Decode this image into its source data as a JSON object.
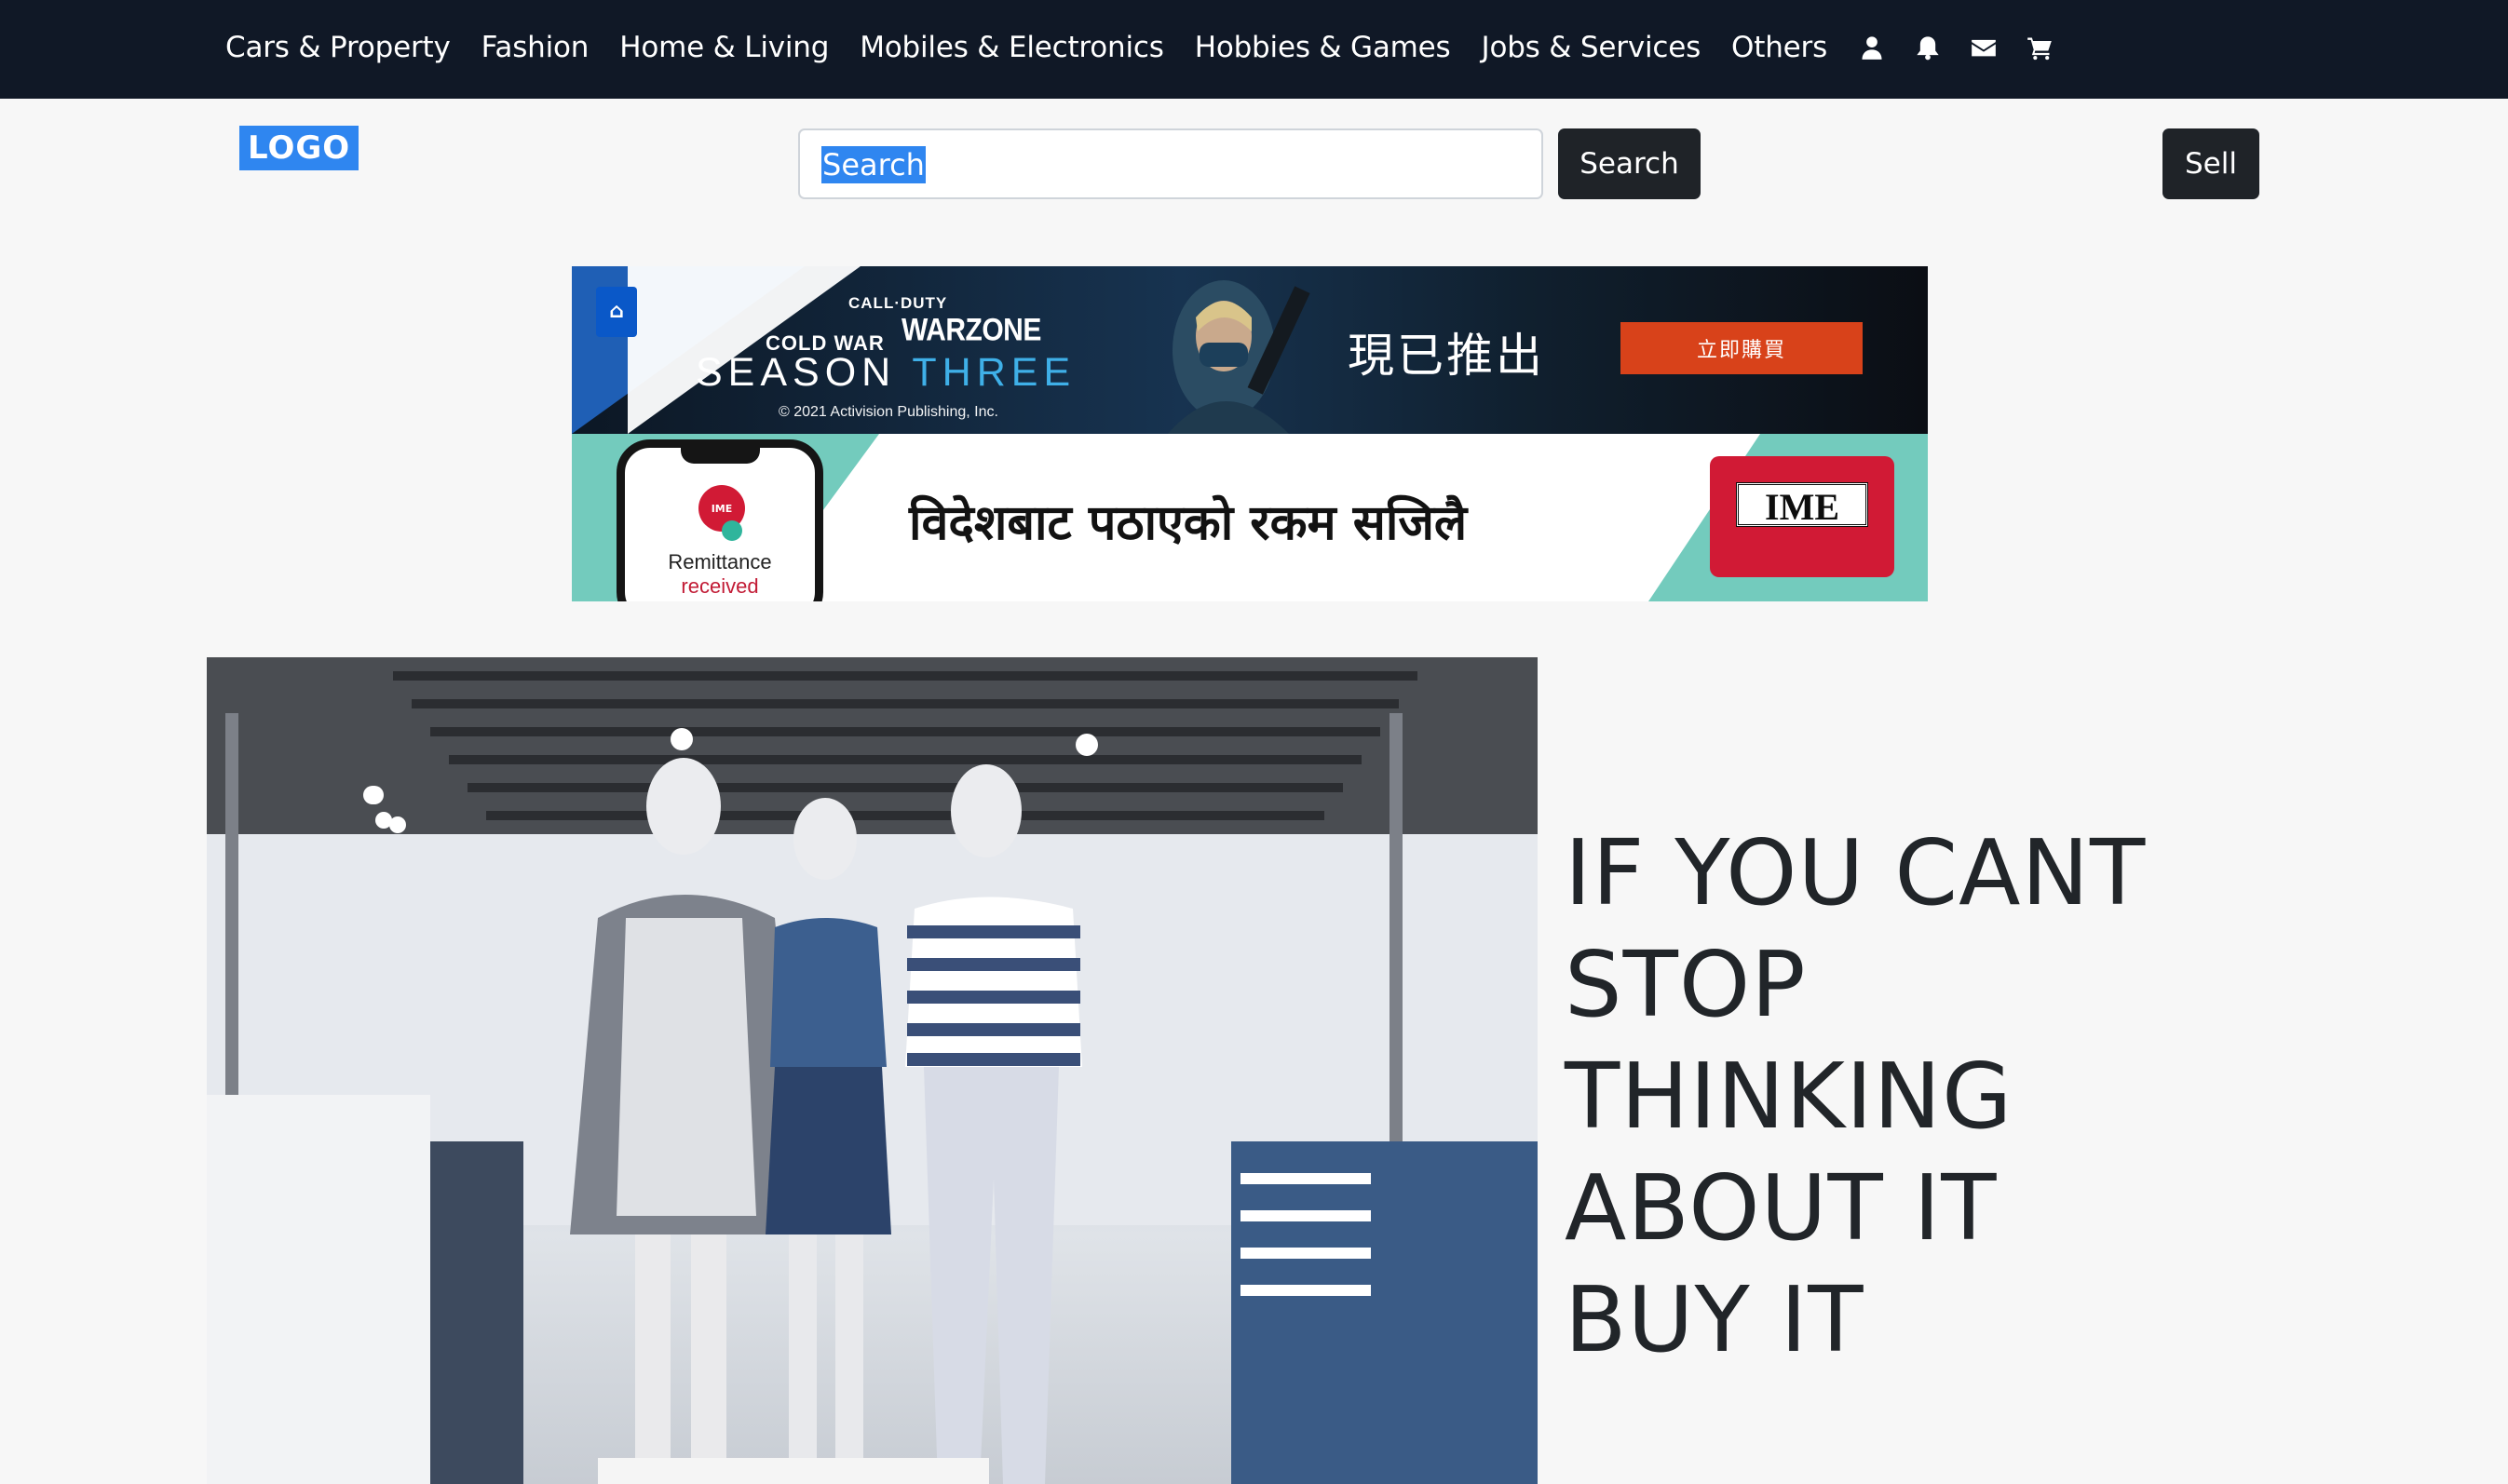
{
  "nav": {
    "items": [
      {
        "label": "Cars & Property"
      },
      {
        "label": "Fashion"
      },
      {
        "label": "Home & Living"
      },
      {
        "label": "Mobiles & Electronics"
      },
      {
        "label": "Hobbies & Games"
      },
      {
        "label": "Jobs & Services"
      },
      {
        "label": "Others"
      }
    ],
    "icons": [
      "user-icon",
      "bell-icon",
      "envelope-icon",
      "cart-icon"
    ]
  },
  "header": {
    "logo": "LOGO",
    "search_placeholder": "Search",
    "search_button": "Search",
    "sell_button": "Sell"
  },
  "ads": {
    "cod": {
      "call_of_duty": "CALL·DUTY",
      "cold_war": "COLD WAR",
      "warzone": "WARZONE",
      "season": "SEASON",
      "three": "THREE",
      "copyright": "© 2021 Activision Publishing, Inc.",
      "chinese_headline": "現已推出",
      "buy_button": "立即購買"
    },
    "ime": {
      "badge": "IME",
      "remittance": "Remittance",
      "received": "received",
      "nepali_text": "विदेशबाट पठाएको रकम सजिलै",
      "logo_text": "IME"
    }
  },
  "hero": {
    "tagline_lines": [
      "IF YOU CANT",
      "STOP",
      "THINKING",
      "ABOUT IT",
      "BUY IT"
    ]
  },
  "colors": {
    "nav_bg": "#101826",
    "page_bg": "#f7f7f7",
    "button_dark": "#1f2328",
    "selection_blue": "#2f86f0",
    "ad_orange": "#d8421a",
    "ime_red": "#d11a35",
    "ime_teal": "#73cbbd"
  }
}
